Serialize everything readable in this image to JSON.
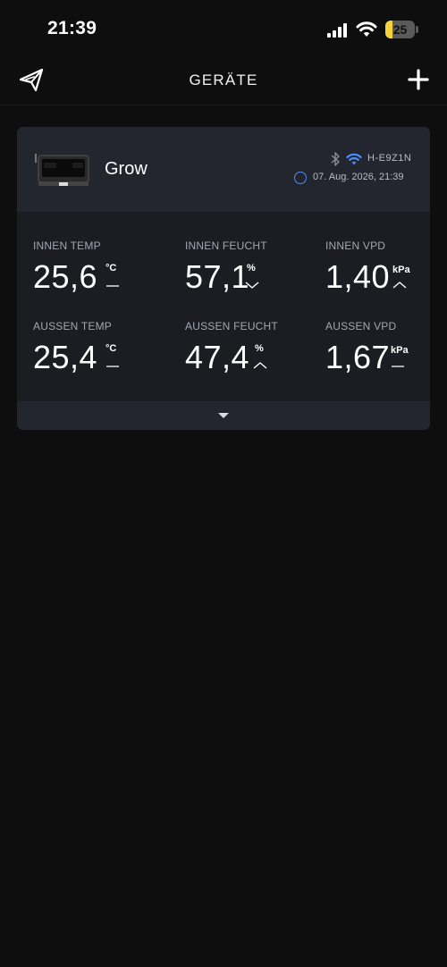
{
  "status_bar": {
    "time": "21:39",
    "battery_level": "25",
    "battery_fraction": 0.25,
    "battery_color": "#f5d33b"
  },
  "nav": {
    "title": "GERÄTE",
    "left_icon": "paper-plane-logo-icon",
    "right_icon": "plus-icon"
  },
  "device": {
    "name": "Grow",
    "id": "H-E9Z1N",
    "timestamp": "07. Aug. 2026, 21:39",
    "bluetooth_icon": "bluetooth-icon",
    "wifi_icon": "wifi-icon",
    "accent_color": "#4a8eff"
  },
  "metrics": {
    "inner_temp": {
      "label": "INNEN TEMP",
      "value": "25,6",
      "unit": "°C",
      "trend": "steady"
    },
    "inner_humidity": {
      "label": "INNEN FEUCHT",
      "value": "57,1",
      "unit": "%",
      "trend": "down"
    },
    "inner_vpd": {
      "label": "INNEN VPD",
      "value": "1,40",
      "unit": "kPa",
      "trend": "up"
    },
    "outer_temp": {
      "label": "AUSSEN TEMP",
      "value": "25,4",
      "unit": "°C",
      "trend": "steady"
    },
    "outer_humidity": {
      "label": "AUSSEN FEUCHT",
      "value": "47,4",
      "unit": "%",
      "trend": "up"
    },
    "outer_vpd": {
      "label": "AUSSEN VPD",
      "value": "1,67",
      "unit": "kPa",
      "trend": "steady"
    }
  }
}
